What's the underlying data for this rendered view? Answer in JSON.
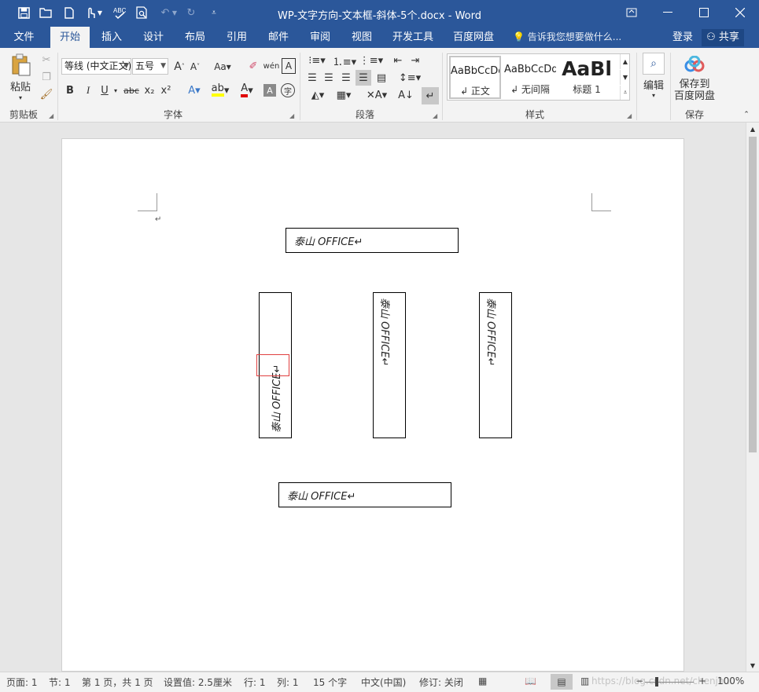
{
  "window": {
    "title": "WP-文字方向-文本框-斜体-5个.docx - Word",
    "controls": [
      "ribbon-options",
      "minimize",
      "maximize",
      "close"
    ]
  },
  "quick_access": {
    "items": [
      "save-icon",
      "open-icon",
      "new-icon",
      "touch-mode-icon",
      "spelling-icon",
      "print-preview-icon",
      "undo-icon",
      "redo-icon",
      "customize-icon"
    ]
  },
  "tabs": [
    "文件",
    "开始",
    "插入",
    "设计",
    "布局",
    "引用",
    "邮件",
    "审阅",
    "视图",
    "开发工具",
    "百度网盘"
  ],
  "active_tab": "开始",
  "tell_me": "告诉我您想要做什么...",
  "account": {
    "login": "登录",
    "share": "共享"
  },
  "ribbon": {
    "clipboard": {
      "label": "剪贴板",
      "paste": "粘贴"
    },
    "font": {
      "label": "字体",
      "font_name": "等线 (中文正文)",
      "font_size": "五号",
      "bold": "B",
      "italic": "I",
      "underline": "U",
      "strike": "abc",
      "subscript": "x₂",
      "superscript": "x²"
    },
    "paragraph": {
      "label": "段落"
    },
    "styles": {
      "label": "样式",
      "cards": [
        {
          "sample": "AaBbCcDd",
          "name": "↲ 正文"
        },
        {
          "sample": "AaBbCcDd",
          "name": "↲ 无间隔"
        },
        {
          "sample": "AaBl",
          "name": "标题 1"
        }
      ]
    },
    "editing": {
      "label": "编辑"
    },
    "save": {
      "label": "保存",
      "button": "保存到百度网盘",
      "line1": "保存到",
      "line2": "百度网盘"
    }
  },
  "document": {
    "paragraph_mark": "↵",
    "textboxes": [
      {
        "id": "top",
        "text": "泰山 OFFICE↵",
        "direction": "horizontal"
      },
      {
        "id": "left",
        "text": "泰山 OFFICE↵",
        "direction": "rotate-270"
      },
      {
        "id": "middle",
        "text": "泰山 OFFICE↵",
        "direction": "rotate-90-stacked"
      },
      {
        "id": "right",
        "text": "泰山 OFFICE↵",
        "direction": "rotate-90"
      },
      {
        "id": "bottom",
        "text": "泰山 OFFICE↵",
        "direction": "horizontal-rotated-glyphs"
      }
    ]
  },
  "status": {
    "page": "页面: 1",
    "section": "节: 1",
    "pages": "第 1 页，共 1 页",
    "position": "设置值: 2.5厘米",
    "line": "行: 1",
    "column": "列: 1",
    "words": "15 个字",
    "language": "中文(中国)",
    "track": "修订: 关闭",
    "zoom": "100%",
    "watermark": "https://blog.csdn.net/chenjh..."
  }
}
